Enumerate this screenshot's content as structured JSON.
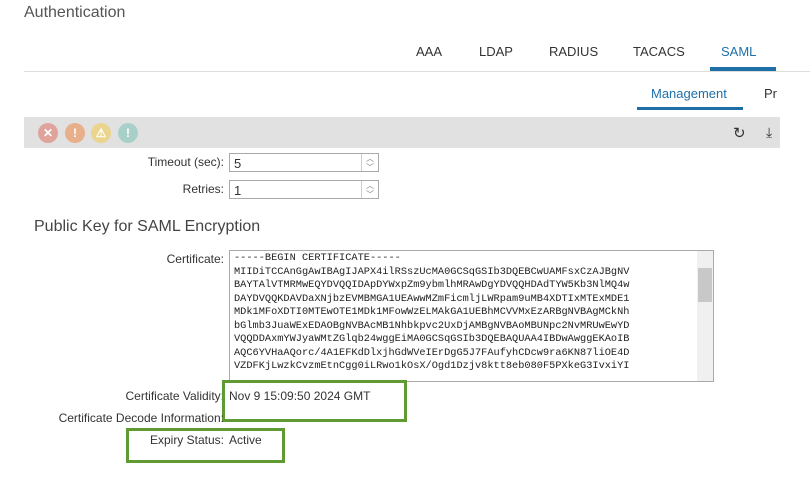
{
  "header": {
    "title": "Authentication"
  },
  "tabs": [
    "AAA",
    "LDAP",
    "RADIUS",
    "TACACS",
    "SAML"
  ],
  "active_tab": "SAML",
  "subtabs": [
    "Management",
    "Pr"
  ],
  "toolbar": {
    "icons": [
      "error-filter-icon",
      "warning-down-filter-icon",
      "warning-filter-icon",
      "info-filter-icon"
    ],
    "refresh": "↻",
    "download": "⤓"
  },
  "form": {
    "timeout_label": "Timeout (sec):",
    "timeout_value": "5",
    "retries_label": "Retries:",
    "retries_value": "1",
    "section_title": "Public Key for SAML Encryption",
    "certificate_label": "Certificate:",
    "certificate_value": "-----BEGIN CERTIFICATE-----\nMIIDiTCCAnGgAwIBAgIJAPX4ilRSszUcMA0GCSqGSIb3DQEBCwUAMFsxCzAJBgNV\nBAYTAlVTMRMwEQYDVQQIDApDYWxpZm9ybmlhMRAwDgYDVQQHDAdTYW5Kb3NlMQ4w\nDAYDVQQKDAVDaXNjbzEVMBMGA1UEAwwMZmFicmljLWRpam9uMB4XDTIxMTExMDE1\nMDk1MFoXDTI0MTEwOTE1MDk1MFowWzELMAkGA1UEBhMCVVMxEzARBgNVBAgMCkNh\nbGlmb3JuaWExEDAOBgNVBAcMB1Nhbkpvc2UxDjAMBgNVBAoMBUNpc2NvMRUwEwYD\nVQQDDAxmYWJyaWMtZGlqb24wggEiMA0GCSqGSIb3DQEBAQUAA4IBDwAwggEKAoIB\nAQC6YVHaAQorc/4A1EFKdDlxjhGdWVeIErDgG5J7FAufyhCDcw9ra6KN87liOE4D\nVZDFKjLwzkCvzmEtnCgg0iLRwo1kOsX/Ogd1Dzjv8ktt8eb080F5PXkeG3IvxiYI",
    "validity_label": "Certificate Validity:",
    "validity_value": "Nov 9 15:09:50 2024 GMT",
    "decode_label": "Certificate Decode Information:",
    "expiry_label": "Expiry Status:",
    "expiry_value": "Active"
  }
}
